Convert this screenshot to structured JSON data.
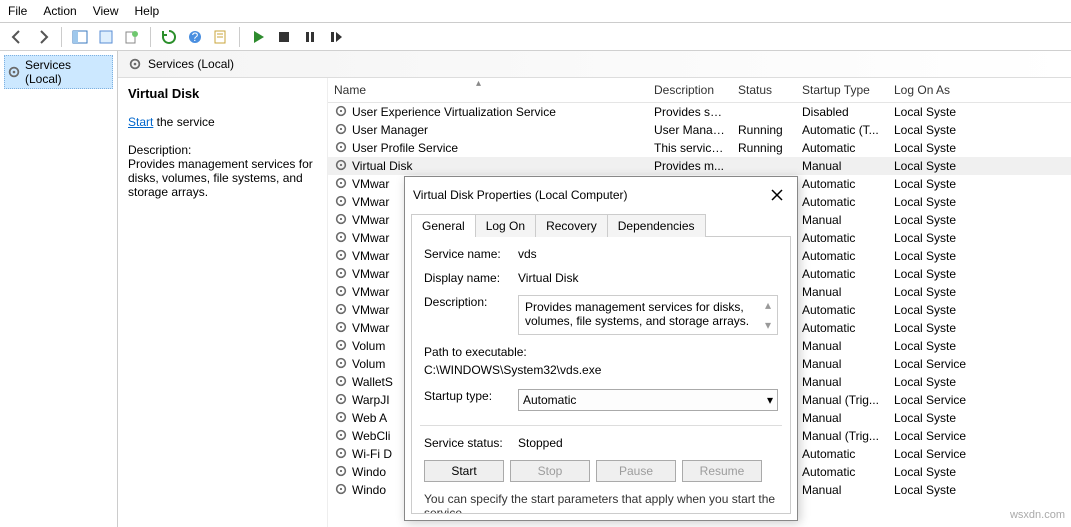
{
  "menu": {
    "file": "File",
    "action": "Action",
    "view": "View",
    "help": "Help"
  },
  "tree": {
    "root": "Services (Local)"
  },
  "header": {
    "title": "Services (Local)"
  },
  "details": {
    "title": "Virtual Disk",
    "start_link": "Start",
    "start_suffix": " the service",
    "desc_label": "Description:",
    "desc_text": "Provides management services for disks, volumes, file systems, and storage arrays."
  },
  "columns": {
    "name": "Name",
    "description": "Description",
    "status": "Status",
    "startup": "Startup Type",
    "logon": "Log On As"
  },
  "services": [
    {
      "name": "User Experience Virtualization Service",
      "desc": "Provides su...",
      "status": "",
      "startup": "Disabled",
      "logon": "Local Syste"
    },
    {
      "name": "User Manager",
      "desc": "User Manag...",
      "status": "Running",
      "startup": "Automatic (T...",
      "logon": "Local Syste"
    },
    {
      "name": "User Profile Service",
      "desc": "This service ...",
      "status": "Running",
      "startup": "Automatic",
      "logon": "Local Syste"
    },
    {
      "name": "Virtual Disk",
      "desc": "Provides m...",
      "status": "",
      "startup": "Manual",
      "logon": "Local Syste",
      "selected": true
    },
    {
      "name": "VMwar",
      "desc": "",
      "status": "",
      "startup": "Automatic",
      "logon": "Local Syste"
    },
    {
      "name": "VMwar",
      "desc": "",
      "status": "",
      "startup": "Automatic",
      "logon": "Local Syste"
    },
    {
      "name": "VMwar",
      "desc": "",
      "status": "",
      "startup": "Manual",
      "logon": "Local Syste"
    },
    {
      "name": "VMwar",
      "desc": "",
      "status": "",
      "startup": "Automatic",
      "logon": "Local Syste"
    },
    {
      "name": "VMwar",
      "desc": "",
      "status": "",
      "startup": "Automatic",
      "logon": "Local Syste"
    },
    {
      "name": "VMwar",
      "desc": "",
      "status": "",
      "startup": "Automatic",
      "logon": "Local Syste"
    },
    {
      "name": "VMwar",
      "desc": "",
      "status": "",
      "startup": "Manual",
      "logon": "Local Syste"
    },
    {
      "name": "VMwar",
      "desc": "",
      "status": "",
      "startup": "Automatic",
      "logon": "Local Syste"
    },
    {
      "name": "VMwar",
      "desc": "",
      "status": "",
      "startup": "Automatic",
      "logon": "Local Syste"
    },
    {
      "name": "Volum",
      "desc": "",
      "status": "",
      "startup": "Manual",
      "logon": "Local Syste"
    },
    {
      "name": "Volum",
      "desc": "",
      "status": "",
      "startup": "Manual",
      "logon": "Local Service"
    },
    {
      "name": "WalletS",
      "desc": "",
      "status": "",
      "startup": "Manual",
      "logon": "Local Syste"
    },
    {
      "name": "WarpJI",
      "desc": "",
      "status": "",
      "startup": "Manual (Trig...",
      "logon": "Local Service"
    },
    {
      "name": "Web A",
      "desc": "",
      "status": "",
      "startup": "Manual",
      "logon": "Local Syste"
    },
    {
      "name": "WebCli",
      "desc": "",
      "status": "",
      "startup": "Manual (Trig...",
      "logon": "Local Service"
    },
    {
      "name": "Wi-Fi D",
      "desc": "",
      "status": "",
      "startup": "Automatic",
      "logon": "Local Service"
    },
    {
      "name": "Windo",
      "desc": "",
      "status": "",
      "startup": "Automatic",
      "logon": "Local Syste"
    },
    {
      "name": "Windo",
      "desc": "",
      "status": "",
      "startup": "Manual",
      "logon": "Local Syste"
    }
  ],
  "dialog": {
    "title": "Virtual Disk Properties (Local Computer)",
    "tabs": {
      "general": "General",
      "logon": "Log On",
      "recovery": "Recovery",
      "dependencies": "Dependencies"
    },
    "fields": {
      "service_name_label": "Service name:",
      "service_name": "vds",
      "display_name_label": "Display name:",
      "display_name": "Virtual Disk",
      "description_label": "Description:",
      "description": "Provides management services for disks, volumes, file systems, and storage arrays.",
      "path_label": "Path to executable:",
      "path": "C:\\WINDOWS\\System32\\vds.exe",
      "startup_label": "Startup type:",
      "startup_value": "Automatic",
      "status_label": "Service status:",
      "status_value": "Stopped",
      "footer_hint": "You can specify the start parameters that apply when you start the service"
    },
    "buttons": {
      "start": "Start",
      "stop": "Stop",
      "pause": "Pause",
      "resume": "Resume"
    }
  },
  "watermark": "wsxdn.com"
}
